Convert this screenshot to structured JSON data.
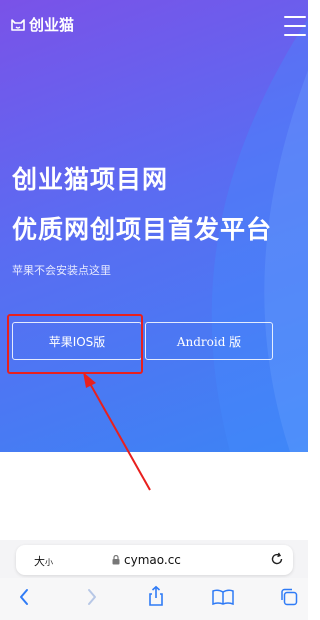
{
  "header": {
    "logo_text": "创业猫"
  },
  "hero": {
    "title_line1": "创业猫项目网",
    "title_line2": "优质网创项目首发平台",
    "subtitle": "苹果不会安装点这里"
  },
  "buttons": {
    "ios_label": "苹果IOS版",
    "android_label": "Android 版"
  },
  "annotation": {
    "color": "#e8201e"
  },
  "browser": {
    "text_size_label": "大",
    "text_size_small": "小",
    "url": "cymao.cc"
  },
  "colors": {
    "accent_blue": "#2f7bf6",
    "gradient_start": "#7a52e8",
    "gradient_end": "#3c84f4"
  }
}
